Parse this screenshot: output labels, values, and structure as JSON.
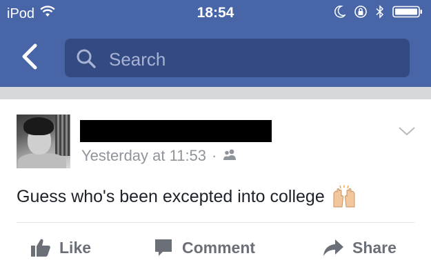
{
  "status_bar": {
    "carrier": "iPod",
    "time": "18:54"
  },
  "nav": {
    "search_placeholder": "Search"
  },
  "post": {
    "timestamp": "Yesterday at 11:53",
    "separator": "·",
    "text": "Guess who's been excepted into college"
  },
  "actions": {
    "like": "Like",
    "comment": "Comment",
    "share": "Share"
  },
  "colors": {
    "header": "#4765a7",
    "search_bg": "#344a83",
    "muted_text": "#8f949b"
  }
}
